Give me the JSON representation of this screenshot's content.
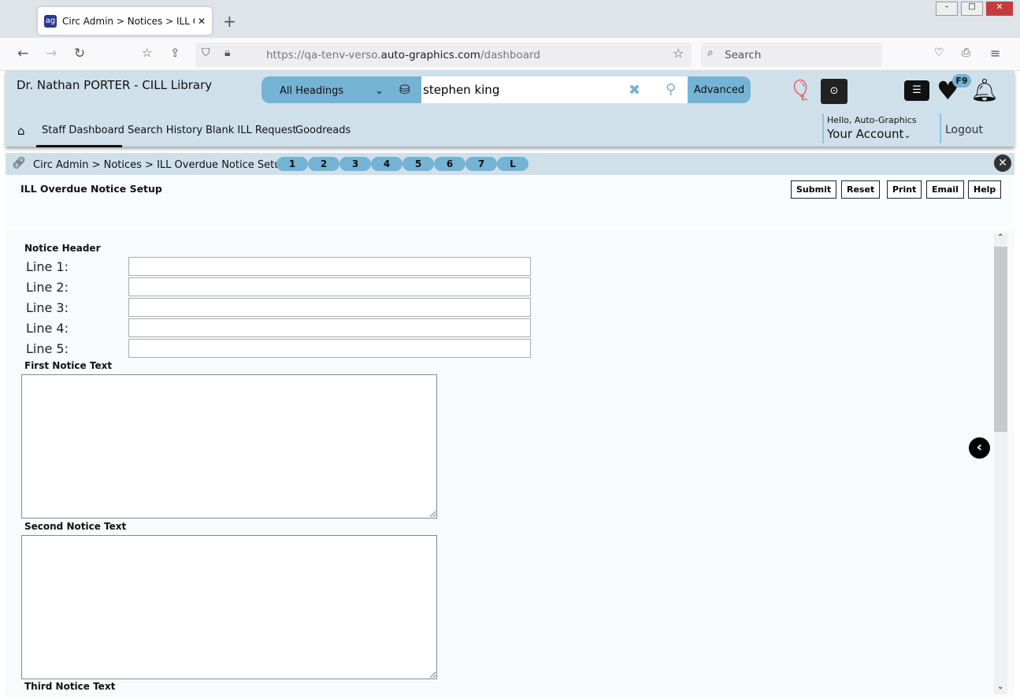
{
  "browser": {
    "tab_title": "Circ Admin > Notices > ILL Overdue Notice Setup",
    "url_prefix": "https://qa-tenv-verso.",
    "url_domain": "auto-graphics.com",
    "url_path": "/dashboard",
    "search_placeholder": "Search"
  },
  "header": {
    "library": "Dr. Nathan PORTER - CILL Library",
    "heading_select": "All Headings",
    "search_value": "stephen king",
    "advanced": "Advanced",
    "badge": "F9",
    "hello": "Hello, Auto-Graphics",
    "account": "Your Account",
    "logout": "Logout"
  },
  "nav": [
    "Staff Dashboard",
    "Search History",
    "Blank ILL Request",
    "Goodreads"
  ],
  "breadcrumb": "Circ Admin > Notices > ILL Overdue Notice Setup",
  "pills": [
    "1",
    "2",
    "3",
    "4",
    "5",
    "6",
    "7",
    "L"
  ],
  "page": {
    "title": "ILL Overdue Notice Setup",
    "buttons": [
      "Submit",
      "Reset",
      "Print",
      "Email",
      "Help"
    ],
    "notice_header": "Notice Header",
    "lines": [
      "Line 1:",
      "Line 2:",
      "Line 3:",
      "Line 4:",
      "Line 5:"
    ],
    "first": "First Notice Text",
    "second": "Second Notice Text",
    "third": "Third Notice Text"
  }
}
